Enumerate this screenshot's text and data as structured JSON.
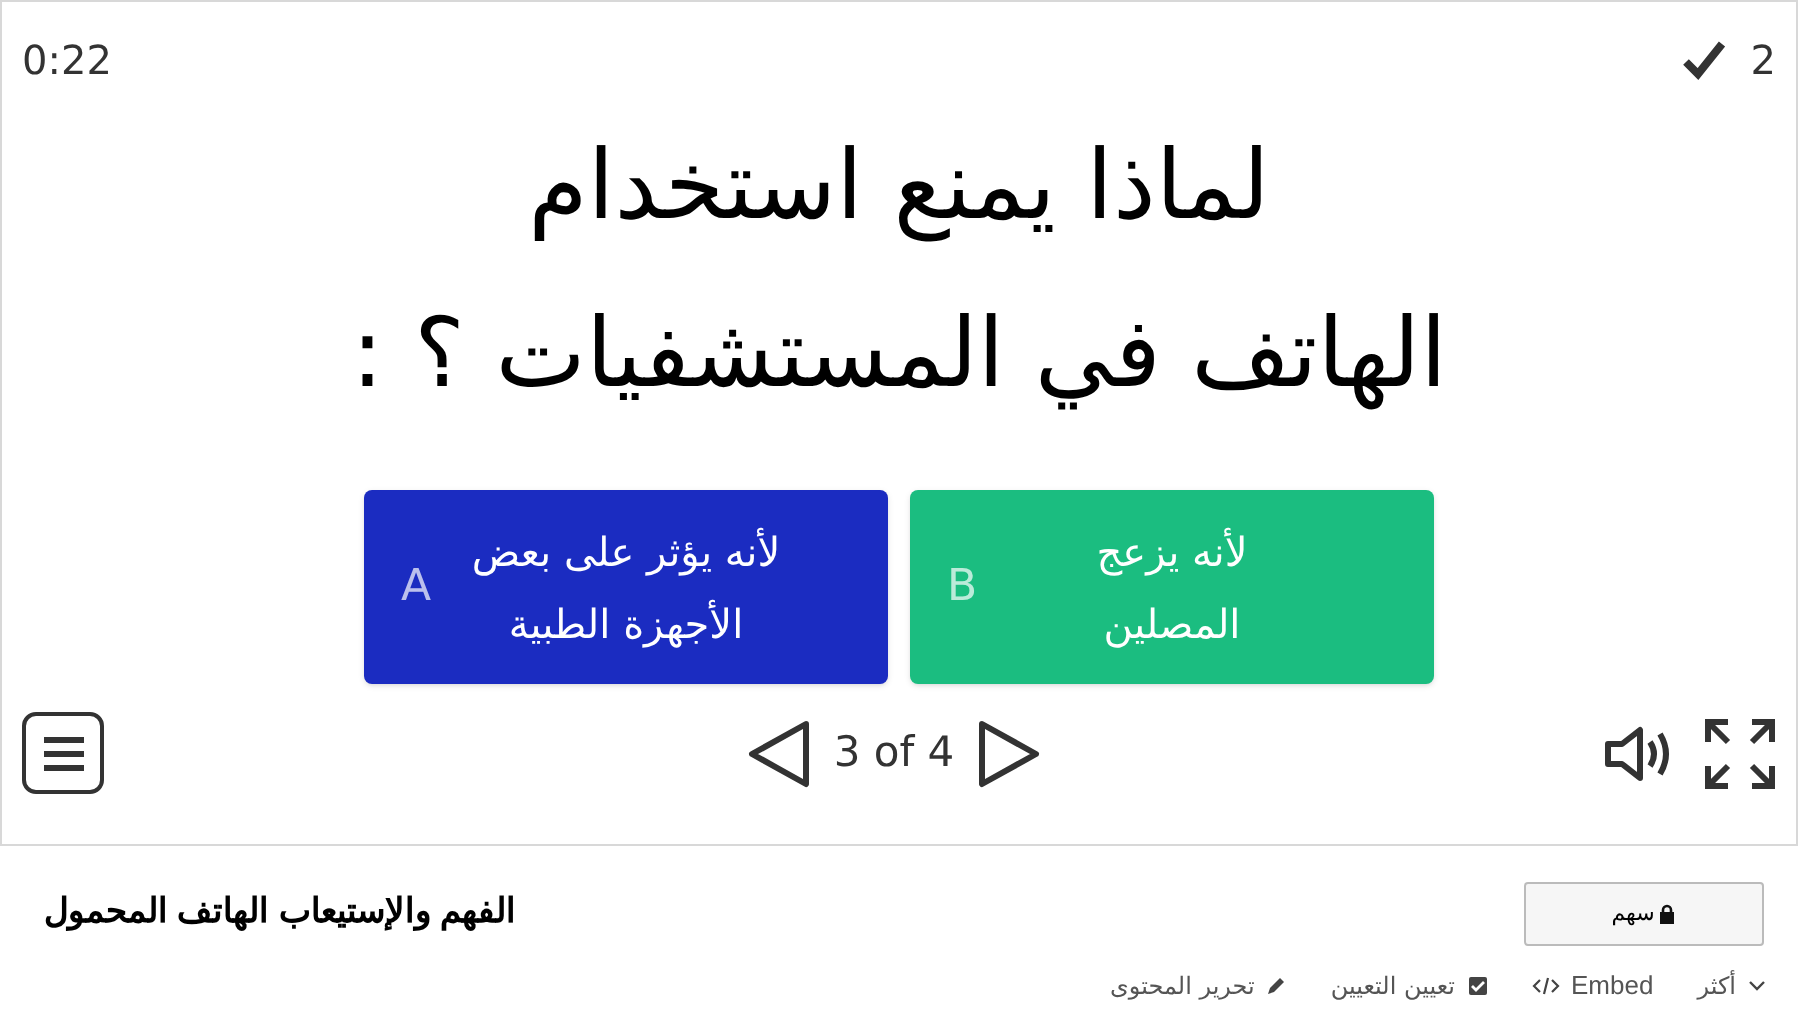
{
  "quiz": {
    "timer": "0:22",
    "score": "2",
    "question_lines": [
      "لماذا يمنع استخدام",
      "الهاتف في المستشفيات ؟ :"
    ],
    "answers": [
      {
        "letter": "B",
        "text_lines": [
          "لأنه يزعج",
          "المصلين"
        ],
        "color": "#1bbd80"
      },
      {
        "letter": "A",
        "text_lines": [
          "لأنه يؤثر على بعض",
          "الأجهزة الطبية"
        ],
        "color": "#1b2cc1"
      }
    ],
    "pager": "3 of 4"
  },
  "footer": {
    "title": "الفهم والإستيعاب الهاتف المحمول",
    "share_button": "سهم",
    "links": [
      {
        "kind": "more",
        "label": "أكثر"
      },
      {
        "kind": "embed",
        "label": "Embed"
      },
      {
        "kind": "assign",
        "label": "تعيين التعيين"
      },
      {
        "kind": "edit",
        "label": "تحرير المحتوى"
      }
    ]
  }
}
